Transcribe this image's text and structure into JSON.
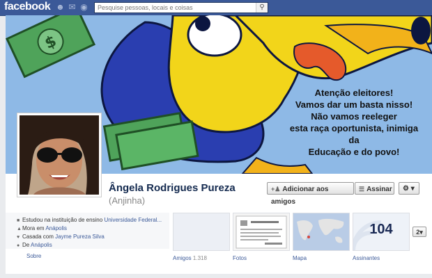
{
  "topbar": {
    "logo": "facebook",
    "search_placeholder": "Pesquise pessoas, locais e coisas"
  },
  "cover": {
    "text_lines": [
      "Atenção eleitores!",
      "Vamos dar um basta nisso!",
      "Não vamos reeleger",
      "esta raça oportunista, inimiga",
      "da",
      "Educação e do povo!"
    ]
  },
  "profile": {
    "name": "Ângela Rodrigues Pureza",
    "nickname": "(Anjinha)"
  },
  "actions": {
    "add_friend": "Adicionar aos amigos",
    "subscribe": "Assinar"
  },
  "info": {
    "studied_prefix": "Estudou na instituição de ensino",
    "studied_link": "Universidade Federal...",
    "lives_prefix": "Mora em",
    "lives_link": "Anápolis",
    "married_prefix": "Casada com",
    "married_link": "Jayme Pureza Silva",
    "from_prefix": "De",
    "from_link": "Anápolis",
    "about_link": "Sobre"
  },
  "tiles": {
    "friends_label": "Amigos",
    "friends_count": "1.318",
    "photos_label": "Fotos",
    "map_label": "Mapa",
    "subscribers_label": "Assinantes",
    "subscribers_count": "104",
    "more_count": "2"
  },
  "colors": {
    "fb_blue": "#3b5998",
    "cover_sky": "#8eb9e6",
    "toucan_yellow": "#f2d51a",
    "toucan_blue": "#2a3eb0",
    "money_green": "#4fa35a"
  }
}
